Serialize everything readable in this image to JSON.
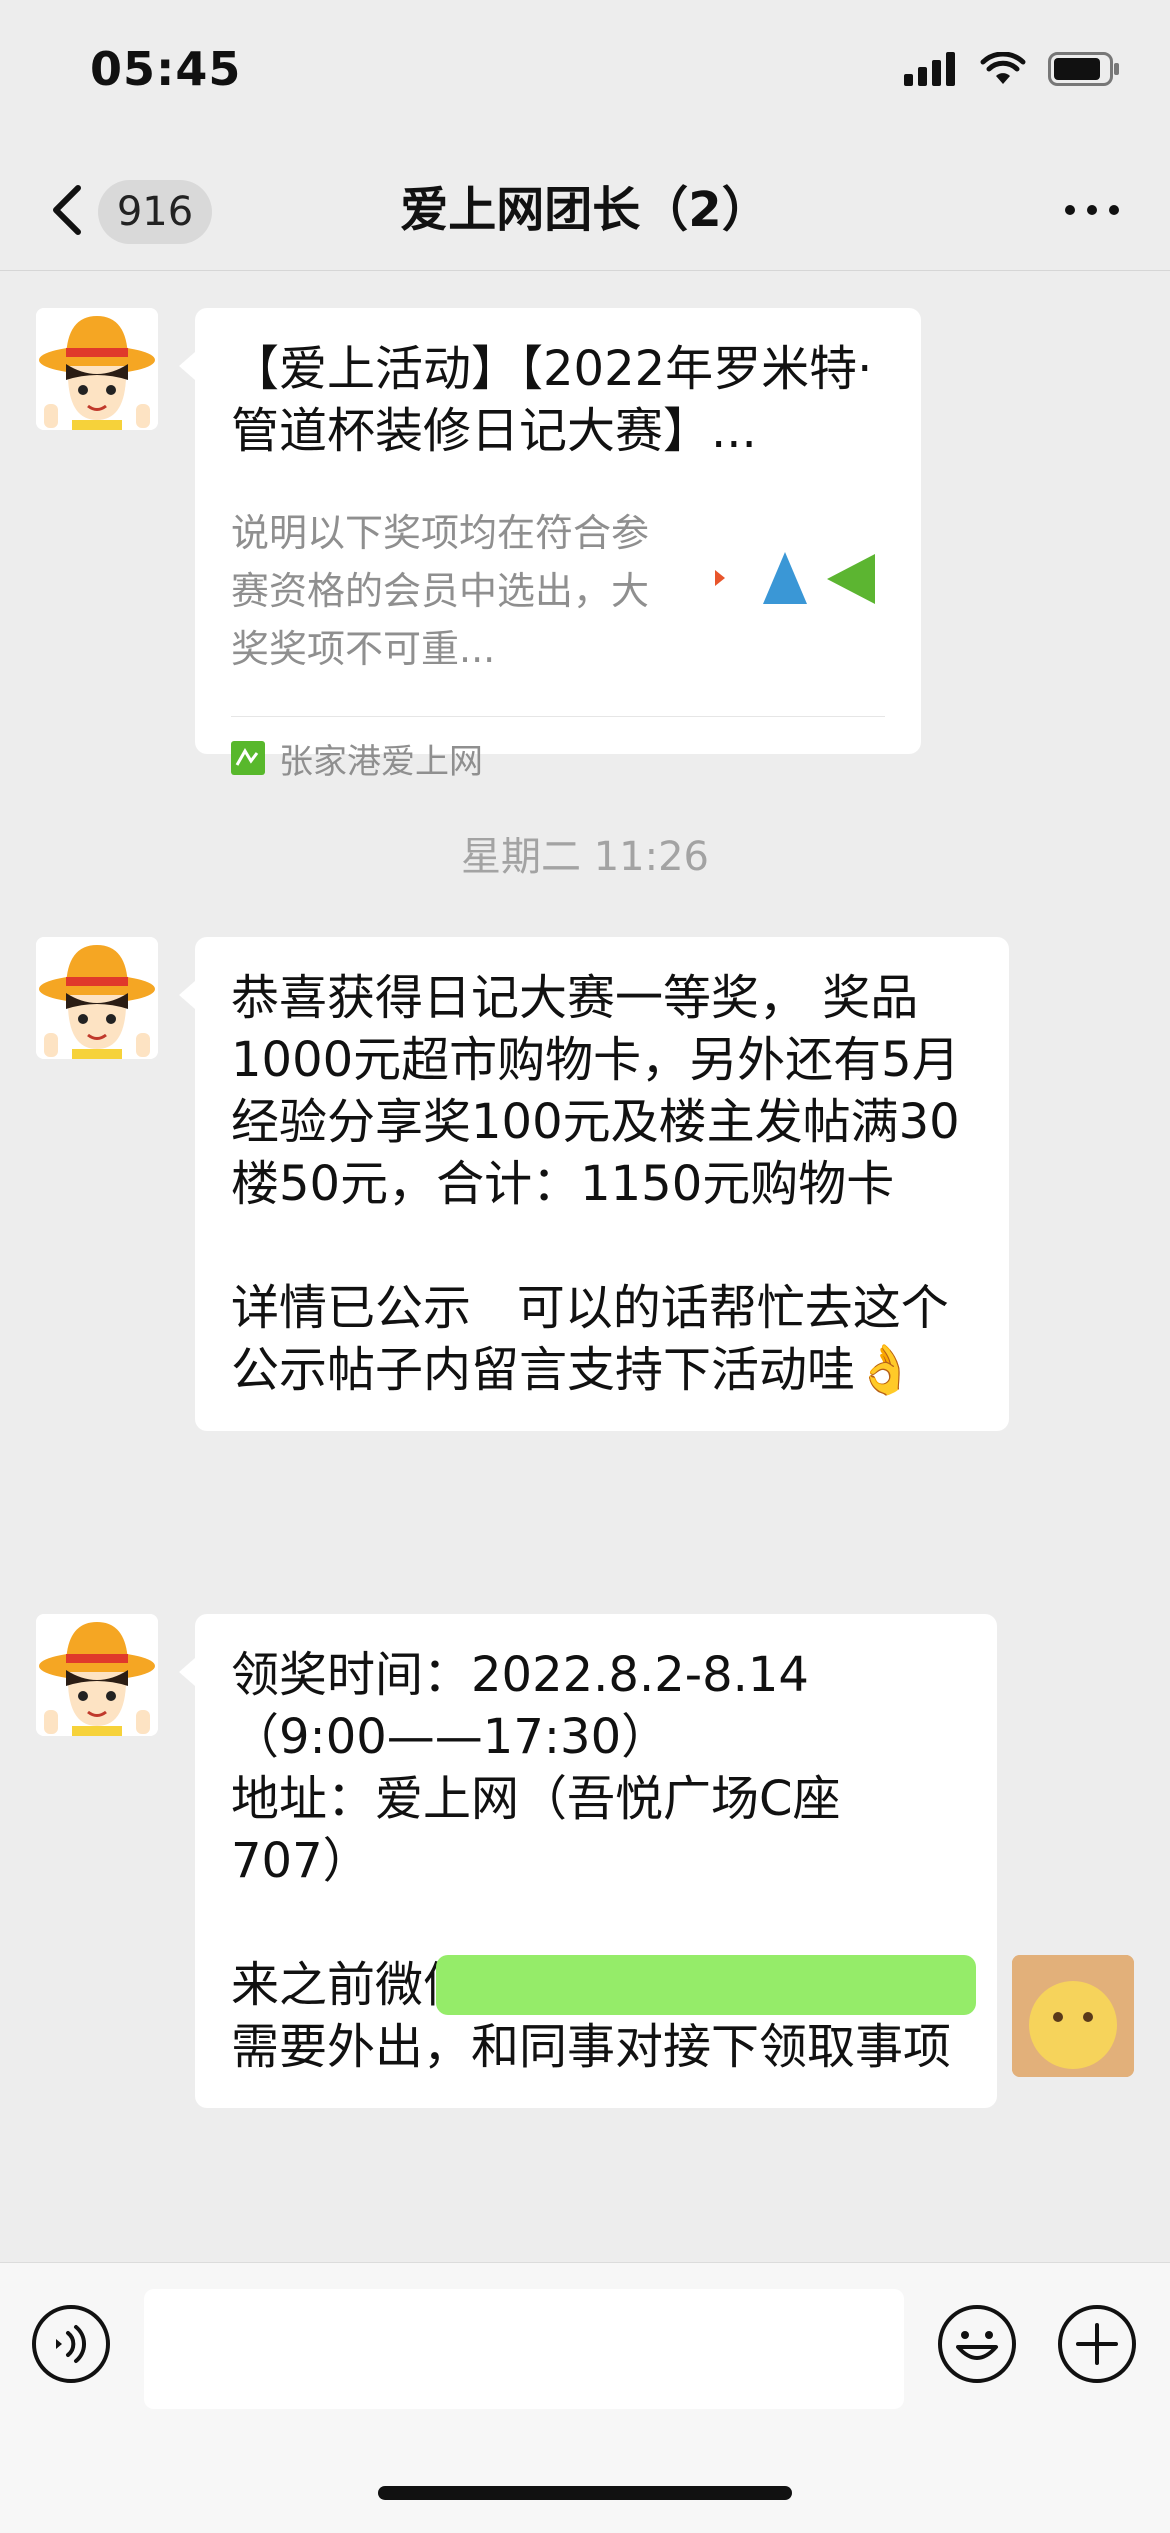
{
  "status_bar": {
    "time": "05:45"
  },
  "nav": {
    "badge": "916",
    "title": "爱上网团长（2）"
  },
  "messages": [
    {
      "type": "link_card",
      "title": "【爱上活动】【2022年罗米特·管道杯装修日记大赛】...",
      "description": "说明以下奖项均在符合参赛资格的会员中选出，大奖奖项不可重...",
      "source": "张家港爱上网"
    },
    {
      "type": "timestamp",
      "text": "星期二 11:26"
    },
    {
      "type": "text",
      "text": "恭喜获得日记大赛一等奖， 奖品1000元超市购物卡，另外还有5月经验分享奖100元及楼主发帖满30楼50元，合计：1150元购物卡\n\n详情已公示   可以的话帮忙去这个公示帖子内留言支持下活动哇👌"
    },
    {
      "type": "text",
      "text": "领奖时间：2022.8.2-8.14（9:00——17:30）\n地址：爱上网（吾悦广场C座707）\n\n来之前微信或电话联系，有时候我需要外出，和同事对接下领取事项"
    }
  ],
  "colors": {
    "self_bubble": "#95ec69",
    "background": "#ededed"
  },
  "icons": {
    "back": "chevron-left-icon",
    "more": "more-dots-icon",
    "voice": "voice-icon",
    "emoji": "emoji-icon",
    "plus": "plus-icon"
  }
}
